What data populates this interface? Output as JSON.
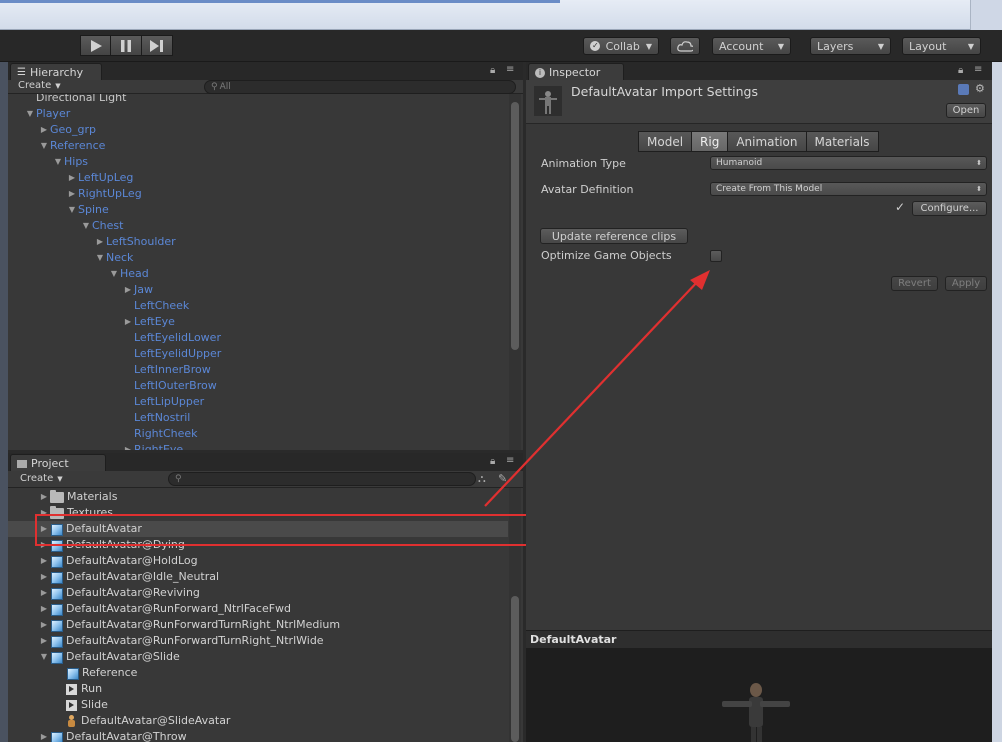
{
  "toolbar": {
    "collab_label": "Collab",
    "account_label": "Account",
    "layers_label": "Layers",
    "layout_label": "Layout"
  },
  "hierarchy": {
    "tab_label": "Hierarchy",
    "create_label": "Create",
    "search_placeholder": "All",
    "rows": [
      {
        "label": "Directional Light",
        "depth": 0,
        "arrow": "",
        "color": "grey"
      },
      {
        "label": "Player",
        "depth": 0,
        "arrow": "down"
      },
      {
        "label": "Geo_grp",
        "depth": 1,
        "arrow": "right"
      },
      {
        "label": "Reference",
        "depth": 1,
        "arrow": "down"
      },
      {
        "label": "Hips",
        "depth": 2,
        "arrow": "down"
      },
      {
        "label": "LeftUpLeg",
        "depth": 3,
        "arrow": "right"
      },
      {
        "label": "RightUpLeg",
        "depth": 3,
        "arrow": "right"
      },
      {
        "label": "Spine",
        "depth": 3,
        "arrow": "down"
      },
      {
        "label": "Chest",
        "depth": 4,
        "arrow": "down"
      },
      {
        "label": "LeftShoulder",
        "depth": 5,
        "arrow": "right"
      },
      {
        "label": "Neck",
        "depth": 5,
        "arrow": "down"
      },
      {
        "label": "Head",
        "depth": 6,
        "arrow": "down"
      },
      {
        "label": "Jaw",
        "depth": 7,
        "arrow": "right"
      },
      {
        "label": "LeftCheek",
        "depth": 7,
        "arrow": ""
      },
      {
        "label": "LeftEye",
        "depth": 7,
        "arrow": "right"
      },
      {
        "label": "LeftEyelidLower",
        "depth": 7,
        "arrow": ""
      },
      {
        "label": "LeftEyelidUpper",
        "depth": 7,
        "arrow": ""
      },
      {
        "label": "LeftInnerBrow",
        "depth": 7,
        "arrow": ""
      },
      {
        "label": "LeftIOuterBrow",
        "depth": 7,
        "arrow": ""
      },
      {
        "label": "LeftLipUpper",
        "depth": 7,
        "arrow": ""
      },
      {
        "label": "LeftNostril",
        "depth": 7,
        "arrow": ""
      },
      {
        "label": "RightCheek",
        "depth": 7,
        "arrow": ""
      },
      {
        "label": "RightEye",
        "depth": 7,
        "arrow": "right"
      }
    ]
  },
  "project": {
    "tab_label": "Project",
    "create_label": "Create",
    "rows": [
      {
        "label": "Materials",
        "indent": 1,
        "arrow": "right",
        "icon": "folder"
      },
      {
        "label": "Textures",
        "indent": 1,
        "arrow": "right",
        "icon": "folder"
      },
      {
        "label": "DefaultAvatar",
        "indent": 1,
        "arrow": "right",
        "icon": "cube",
        "selected": true
      },
      {
        "label": "DefaultAvatar@Dying",
        "indent": 1,
        "arrow": "right",
        "icon": "cube"
      },
      {
        "label": "DefaultAvatar@HoldLog",
        "indent": 1,
        "arrow": "right",
        "icon": "cube"
      },
      {
        "label": "DefaultAvatar@Idle_Neutral",
        "indent": 1,
        "arrow": "right",
        "icon": "cube"
      },
      {
        "label": "DefaultAvatar@Reviving",
        "indent": 1,
        "arrow": "right",
        "icon": "cube"
      },
      {
        "label": "DefaultAvatar@RunForward_NtrlFaceFwd",
        "indent": 1,
        "arrow": "right",
        "icon": "cube"
      },
      {
        "label": "DefaultAvatar@RunForwardTurnRight_NtrlMedium",
        "indent": 1,
        "arrow": "right",
        "icon": "cube"
      },
      {
        "label": "DefaultAvatar@RunForwardTurnRight_NtrlWide",
        "indent": 1,
        "arrow": "right",
        "icon": "cube"
      },
      {
        "label": "DefaultAvatar@Slide",
        "indent": 1,
        "arrow": "down",
        "icon": "cube"
      },
      {
        "label": "Reference",
        "indent": 2,
        "arrow": "",
        "icon": "cube"
      },
      {
        "label": "Run",
        "indent": 2,
        "arrow": "",
        "icon": "anim"
      },
      {
        "label": "Slide",
        "indent": 2,
        "arrow": "",
        "icon": "anim"
      },
      {
        "label": "DefaultAvatar@SlideAvatar",
        "indent": 2,
        "arrow": "",
        "icon": "avatar"
      },
      {
        "label": "DefaultAvatar@Throw",
        "indent": 1,
        "arrow": "right",
        "icon": "cube"
      }
    ]
  },
  "inspector": {
    "tab_label": "Inspector",
    "title": "DefaultAvatar Import Settings",
    "open_label": "Open",
    "tabs": [
      "Model",
      "Rig",
      "Animation",
      "Materials"
    ],
    "active_tab": "Rig",
    "animation_type_label": "Animation Type",
    "animation_type_value": "Humanoid",
    "avatar_definition_label": "Avatar Definition",
    "avatar_definition_value": "Create From This Model",
    "checkmark": "✓",
    "configure_label": "Configure...",
    "update_clips_label": "Update reference clips",
    "optimize_label": "Optimize Game Objects",
    "revert_label": "Revert",
    "apply_label": "Apply",
    "preview_title": "DefaultAvatar"
  },
  "annotation_color": "#e03030"
}
